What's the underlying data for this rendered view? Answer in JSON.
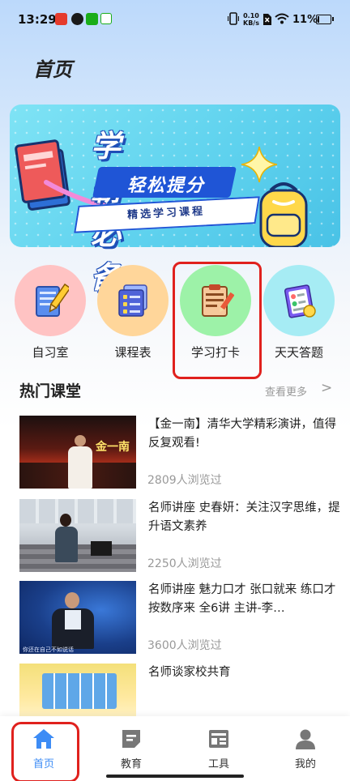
{
  "status_bar": {
    "time": "13:29",
    "net_speed_value": "0.10",
    "net_speed_unit": "KB/s",
    "battery": "11%",
    "battery_level": 0.11
  },
  "page": {
    "title": "首页"
  },
  "banner": {
    "headline": "学霸必备",
    "subline": "轻松提分",
    "tag": "精选学习课程"
  },
  "quick_entries": [
    {
      "label": "自习室",
      "icon": "pencil-notepad-icon",
      "bg": "#ffc3c3"
    },
    {
      "label": "课程表",
      "icon": "schedule-list-icon",
      "bg": "#ffd69a"
    },
    {
      "label": "学习打卡",
      "icon": "clipboard-check-icon",
      "bg": "#9df2a8"
    },
    {
      "label": "天天答题",
      "icon": "quiz-notebook-icon",
      "bg": "#a6ecf4"
    }
  ],
  "hot_section": {
    "title": "热门课堂",
    "more_label": "查看更多",
    "more_arrow": ">"
  },
  "courses": [
    {
      "title": "【金一南】清华大学精彩演讲，值得反复观看!",
      "views": "2809人浏览过",
      "thumb_text": "金一南"
    },
    {
      "title": "名师讲座 史春妍：关注汉字思维，提升语文素养",
      "views": "2250人浏览过"
    },
    {
      "title": "名师讲座 魅力口才 张口就来 练口才按数序来 全6讲 主讲-李…",
      "views": "3600人浏览过",
      "thumb_text": "你还在自己不如说话"
    },
    {
      "title": "名师谈家校共育",
      "views": ""
    }
  ],
  "tabbar": {
    "items": [
      {
        "label": "首页",
        "icon": "home-icon",
        "active": true
      },
      {
        "label": "教育",
        "icon": "document-icon",
        "active": false
      },
      {
        "label": "工具",
        "icon": "toolbox-icon",
        "active": false
      },
      {
        "label": "我的",
        "icon": "user-icon",
        "active": false
      }
    ]
  },
  "colors": {
    "accent": "#3d8cf5",
    "highlight_border": "#e0211d",
    "text_primary": "#222222",
    "text_secondary": "#999999"
  }
}
